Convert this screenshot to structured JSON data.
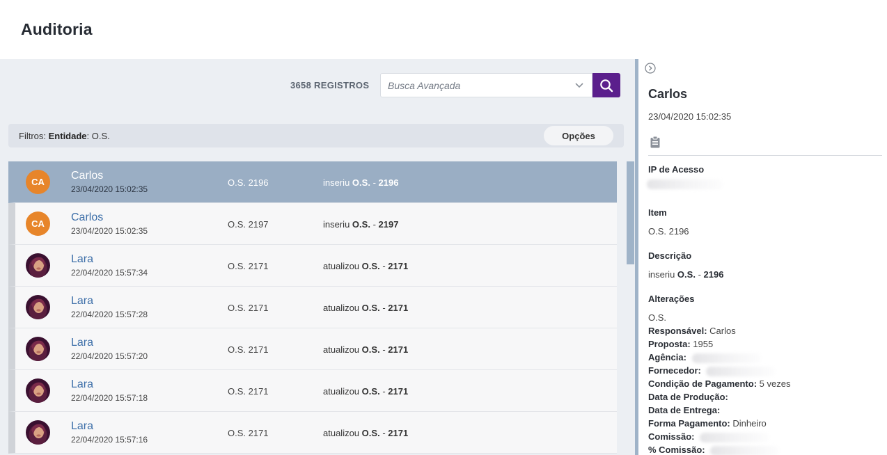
{
  "page": {
    "title": "Auditoria"
  },
  "toolbar": {
    "records_count": "3658 REGISTROS",
    "search_placeholder": "Busca Avançada"
  },
  "filters": {
    "prefix": "Filtros:",
    "entity_label": "Entidade",
    "entity_value": "O.S.",
    "options_label": "Opções"
  },
  "records": [
    {
      "initials": "CA",
      "name": "Carlos",
      "date": "23/04/2020 15:02:35",
      "item": "O.S. 2196",
      "action": "inseriu",
      "entity": "O.S.",
      "separator": "-",
      "number": "2196",
      "selected": true,
      "avatar": "initials"
    },
    {
      "initials": "CA",
      "name": "Carlos",
      "date": "23/04/2020 15:02:35",
      "item": "O.S. 2197",
      "action": "inseriu",
      "entity": "O.S.",
      "separator": "-",
      "number": "2197",
      "selected": false,
      "avatar": "initials"
    },
    {
      "initials": "",
      "name": "Lara",
      "date": "22/04/2020 15:57:34",
      "item": "O.S. 2171",
      "action": "atualizou",
      "entity": "O.S.",
      "separator": "-",
      "number": "2171",
      "selected": false,
      "avatar": "photo"
    },
    {
      "initials": "",
      "name": "Lara",
      "date": "22/04/2020 15:57:28",
      "item": "O.S. 2171",
      "action": "atualizou",
      "entity": "O.S.",
      "separator": "-",
      "number": "2171",
      "selected": false,
      "avatar": "photo"
    },
    {
      "initials": "",
      "name": "Lara",
      "date": "22/04/2020 15:57:20",
      "item": "O.S. 2171",
      "action": "atualizou",
      "entity": "O.S.",
      "separator": "-",
      "number": "2171",
      "selected": false,
      "avatar": "photo"
    },
    {
      "initials": "",
      "name": "Lara",
      "date": "22/04/2020 15:57:18",
      "item": "O.S. 2171",
      "action": "atualizou",
      "entity": "O.S.",
      "separator": "-",
      "number": "2171",
      "selected": false,
      "avatar": "photo"
    },
    {
      "initials": "",
      "name": "Lara",
      "date": "22/04/2020 15:57:16",
      "item": "O.S. 2171",
      "action": "atualizou",
      "entity": "O.S.",
      "separator": "-",
      "number": "2171",
      "selected": false,
      "avatar": "photo"
    }
  ],
  "detail": {
    "name": "Carlos",
    "date": "23/04/2020 15:02:35",
    "ip_label": "IP de Acesso",
    "item_label": "Item",
    "item_value": "O.S. 2196",
    "description_label": "Descrição",
    "description": {
      "action": "inseriu",
      "entity": "O.S.",
      "separator": "-",
      "number": "2196"
    },
    "changes_label": "Alterações",
    "changes_entity": "O.S.",
    "changes": [
      {
        "label": "Responsável:",
        "value": "Carlos",
        "redacted": false
      },
      {
        "label": "Proposta:",
        "value": "1955",
        "redacted": false
      },
      {
        "label": "Agência:",
        "value": "",
        "redacted": true
      },
      {
        "label": "Fornecedor:",
        "value": "",
        "redacted": true
      },
      {
        "label": "Condição de Pagamento:",
        "value": "5 vezes",
        "redacted": false
      },
      {
        "label": "Data de Produção:",
        "value": "",
        "redacted": false
      },
      {
        "label": "Data de Entrega:",
        "value": "",
        "redacted": false
      },
      {
        "label": "Forma Pagamento:",
        "value": "Dinheiro",
        "redacted": false
      },
      {
        "label": "Comissão:",
        "value": "",
        "redacted": true
      },
      {
        "label": "% Comissão:",
        "value": "",
        "redacted": true
      }
    ]
  },
  "colors": {
    "accent": "#5b1f8c",
    "selected_row": "#9aaec4",
    "avatar_orange": "#e7852a",
    "link_blue": "#3c6ea8"
  },
  "icons": {
    "search": "search-icon",
    "dropdown": "chevron-down-icon",
    "collapse": "chevron-right-circle-icon",
    "clipboard": "clipboard-icon"
  }
}
